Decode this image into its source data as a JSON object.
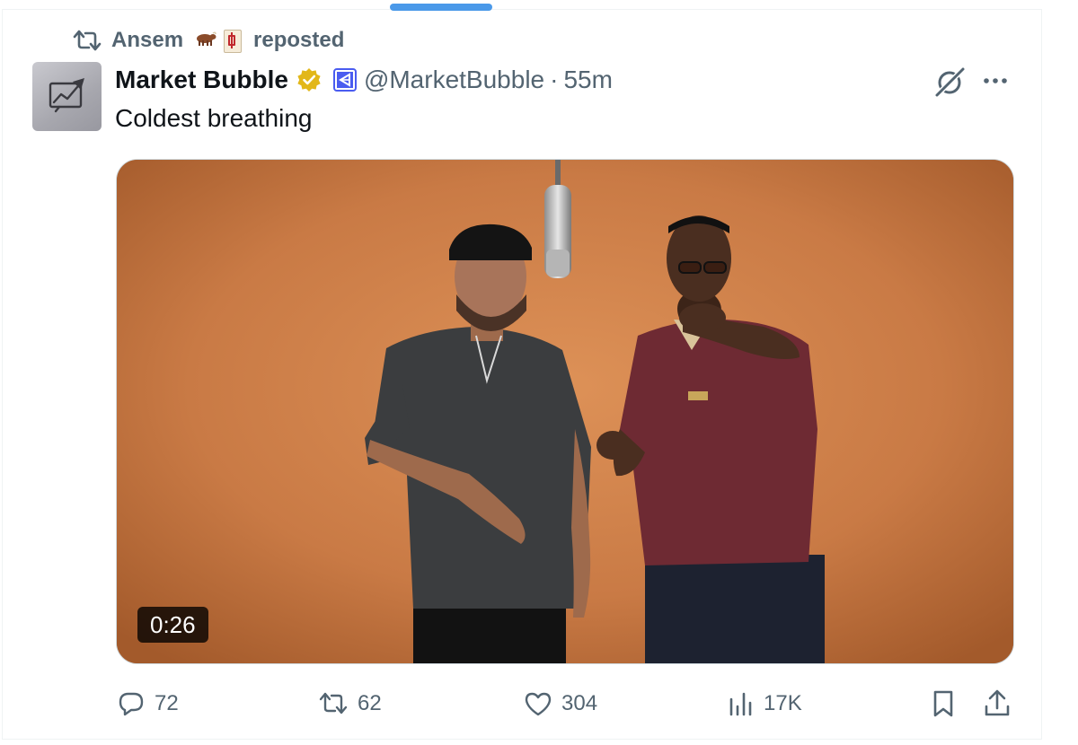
{
  "repost": {
    "user": "Ansem",
    "label": "reposted",
    "emojis": [
      "ox-emoji",
      "mahjong-red-dragon-emoji"
    ]
  },
  "author": {
    "display_name": "Market Bubble",
    "handle": "@MarketBubble",
    "separator": "·",
    "time": "55m"
  },
  "tweet": {
    "text": "Coldest breathing"
  },
  "media": {
    "type": "video",
    "duration": "0:26"
  },
  "actions": {
    "replies": "72",
    "reposts": "62",
    "likes": "304",
    "views": "17K"
  },
  "colors": {
    "secondary_text": "#536471",
    "primary_text": "#0f1419",
    "verified_gold": "#e2b719",
    "affiliate_blue": "#4a5cf0",
    "scroll_indicator": "#4a99e9",
    "media_background": "#c87743"
  },
  "icons": {
    "repost": "repost-icon",
    "verified": "verified-badge-icon",
    "affiliate": "affiliate-badge-icon",
    "grok": "grok-icon",
    "more": "more-icon",
    "reply": "reply-icon",
    "like": "heart-icon",
    "views": "views-icon",
    "bookmark": "bookmark-icon",
    "share": "share-icon"
  }
}
